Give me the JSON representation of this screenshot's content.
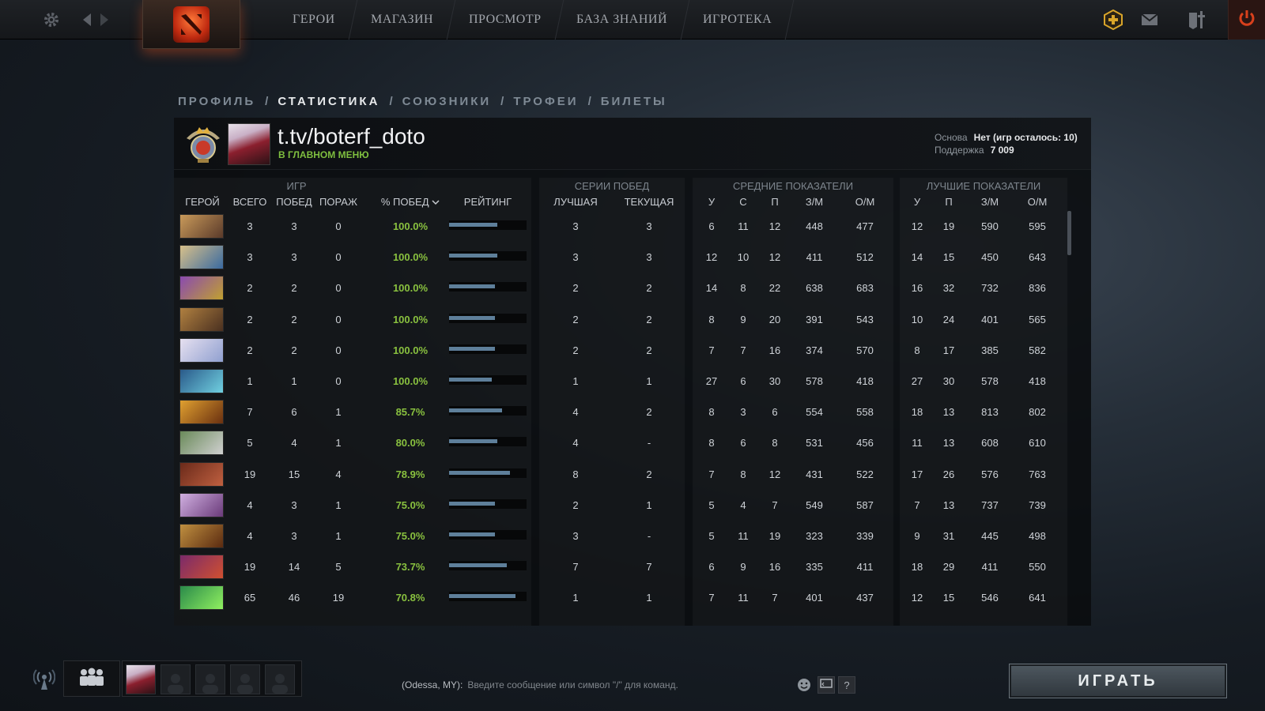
{
  "topbar": {
    "nav": [
      "ГЕРОИ",
      "МАГАЗИН",
      "ПРОСМОТР",
      "БАЗА ЗНАНИЙ",
      "ИГРОТЕКА"
    ]
  },
  "breadcrumbs": [
    "ПРОФИЛЬ",
    "СТАТИСТИКА",
    "СОЮЗНИКИ",
    "ТРОФЕИ",
    "БИЛЕТЫ"
  ],
  "breadcrumb_sep": "/",
  "profile": {
    "name": "t.tv/boterf_doto",
    "status": "В ГЛАВНОМ МЕНЮ",
    "core_label": "Основа",
    "core_value": "Нет (игр осталось: 10)",
    "support_label": "Поддержка",
    "support_value": "7 009"
  },
  "table": {
    "groups": {
      "games": "ИГР",
      "streaks": "СЕРИИ ПОБЕД",
      "avg": "СРЕДНИЕ ПОКАЗАТЕЛИ",
      "best": "ЛУЧШИЕ ПОКАЗАТЕЛИ"
    },
    "columns": {
      "hero": "ГЕРОЙ",
      "total": "ВСЕГО",
      "wins": "ПОБЕД",
      "losses": "ПОРАЖ",
      "winrate": "% ПОБЕД",
      "rating": "РЕЙТИНГ",
      "best_streak": "ЛУЧШАЯ",
      "cur_streak": "ТЕКУЩАЯ",
      "avg_k": "У",
      "avg_d": "С",
      "avg_a": "П",
      "avg_gpm": "З/М",
      "avg_xpm": "О/М",
      "best_k": "У",
      "best_a": "П",
      "best_gpm": "З/М",
      "best_xpm": "О/М"
    },
    "rows": [
      {
        "total": "3",
        "wins": "3",
        "losses": "0",
        "winrate": "100.0%",
        "rating": 0.62,
        "best_streak": "3",
        "cur_streak": "3",
        "avg_k": "6",
        "avg_d": "11",
        "avg_a": "12",
        "avg_gpm": "448",
        "avg_xpm": "477",
        "best_k": "12",
        "best_a": "19",
        "best_gpm": "590",
        "best_xpm": "595"
      },
      {
        "total": "3",
        "wins": "3",
        "losses": "0",
        "winrate": "100.0%",
        "rating": 0.62,
        "best_streak": "3",
        "cur_streak": "3",
        "avg_k": "12",
        "avg_d": "10",
        "avg_a": "12",
        "avg_gpm": "411",
        "avg_xpm": "512",
        "best_k": "14",
        "best_a": "15",
        "best_gpm": "450",
        "best_xpm": "643"
      },
      {
        "total": "2",
        "wins": "2",
        "losses": "0",
        "winrate": "100.0%",
        "rating": 0.59,
        "best_streak": "2",
        "cur_streak": "2",
        "avg_k": "14",
        "avg_d": "8",
        "avg_a": "22",
        "avg_gpm": "638",
        "avg_xpm": "683",
        "best_k": "16",
        "best_a": "32",
        "best_gpm": "732",
        "best_xpm": "836"
      },
      {
        "total": "2",
        "wins": "2",
        "losses": "0",
        "winrate": "100.0%",
        "rating": 0.59,
        "best_streak": "2",
        "cur_streak": "2",
        "avg_k": "8",
        "avg_d": "9",
        "avg_a": "20",
        "avg_gpm": "391",
        "avg_xpm": "543",
        "best_k": "10",
        "best_a": "24",
        "best_gpm": "401",
        "best_xpm": "565"
      },
      {
        "total": "2",
        "wins": "2",
        "losses": "0",
        "winrate": "100.0%",
        "rating": 0.59,
        "best_streak": "2",
        "cur_streak": "2",
        "avg_k": "7",
        "avg_d": "7",
        "avg_a": "16",
        "avg_gpm": "374",
        "avg_xpm": "570",
        "best_k": "8",
        "best_a": "17",
        "best_gpm": "385",
        "best_xpm": "582"
      },
      {
        "total": "1",
        "wins": "1",
        "losses": "0",
        "winrate": "100.0%",
        "rating": 0.55,
        "best_streak": "1",
        "cur_streak": "1",
        "avg_k": "27",
        "avg_d": "6",
        "avg_a": "30",
        "avg_gpm": "578",
        "avg_xpm": "418",
        "best_k": "27",
        "best_a": "30",
        "best_gpm": "578",
        "best_xpm": "418"
      },
      {
        "total": "7",
        "wins": "6",
        "losses": "1",
        "winrate": "85.7%",
        "rating": 0.68,
        "best_streak": "4",
        "cur_streak": "2",
        "avg_k": "8",
        "avg_d": "3",
        "avg_a": "6",
        "avg_gpm": "554",
        "avg_xpm": "558",
        "best_k": "18",
        "best_a": "13",
        "best_gpm": "813",
        "best_xpm": "802"
      },
      {
        "total": "5",
        "wins": "4",
        "losses": "1",
        "winrate": "80.0%",
        "rating": 0.62,
        "best_streak": "4",
        "cur_streak": "-",
        "avg_k": "8",
        "avg_d": "6",
        "avg_a": "8",
        "avg_gpm": "531",
        "avg_xpm": "456",
        "best_k": "11",
        "best_a": "13",
        "best_gpm": "608",
        "best_xpm": "610"
      },
      {
        "total": "19",
        "wins": "15",
        "losses": "4",
        "winrate": "78.9%",
        "rating": 0.79,
        "best_streak": "8",
        "cur_streak": "2",
        "avg_k": "7",
        "avg_d": "8",
        "avg_a": "12",
        "avg_gpm": "431",
        "avg_xpm": "522",
        "best_k": "17",
        "best_a": "26",
        "best_gpm": "576",
        "best_xpm": "763"
      },
      {
        "total": "4",
        "wins": "3",
        "losses": "1",
        "winrate": "75.0%",
        "rating": 0.59,
        "best_streak": "2",
        "cur_streak": "1",
        "avg_k": "5",
        "avg_d": "4",
        "avg_a": "7",
        "avg_gpm": "549",
        "avg_xpm": "587",
        "best_k": "7",
        "best_a": "13",
        "best_gpm": "737",
        "best_xpm": "739"
      },
      {
        "total": "4",
        "wins": "3",
        "losses": "1",
        "winrate": "75.0%",
        "rating": 0.59,
        "best_streak": "3",
        "cur_streak": "-",
        "avg_k": "5",
        "avg_d": "11",
        "avg_a": "19",
        "avg_gpm": "323",
        "avg_xpm": "339",
        "best_k": "9",
        "best_a": "31",
        "best_gpm": "445",
        "best_xpm": "498"
      },
      {
        "total": "19",
        "wins": "14",
        "losses": "5",
        "winrate": "73.7%",
        "rating": 0.74,
        "best_streak": "7",
        "cur_streak": "7",
        "avg_k": "6",
        "avg_d": "9",
        "avg_a": "16",
        "avg_gpm": "335",
        "avg_xpm": "411",
        "best_k": "18",
        "best_a": "29",
        "best_gpm": "411",
        "best_xpm": "550"
      },
      {
        "total": "65",
        "wins": "46",
        "losses": "19",
        "winrate": "70.8%",
        "rating": 0.86,
        "best_streak": "1",
        "cur_streak": "1",
        "avg_k": "7",
        "avg_d": "11",
        "avg_a": "7",
        "avg_gpm": "401",
        "avg_xpm": "437",
        "best_k": "12",
        "best_a": "15",
        "best_gpm": "546",
        "best_xpm": "641"
      }
    ]
  },
  "hero_colors": [
    [
      "#c99a5a",
      "#5a3a2a"
    ],
    [
      "#d8c08a",
      "#3a6aa0"
    ],
    [
      "#8a4ab0",
      "#c0a030"
    ],
    [
      "#b08040",
      "#4a3020"
    ],
    [
      "#e6e0f0",
      "#90a0d0"
    ],
    [
      "#2a5a8a",
      "#70d0e0"
    ],
    [
      "#e0a030",
      "#6a3010"
    ],
    [
      "#6a8a5a",
      "#d0d0d0"
    ],
    [
      "#6a2a1a",
      "#c06040"
    ],
    [
      "#d0b0e0",
      "#6a3a7a"
    ],
    [
      "#c09040",
      "#5a2a10"
    ],
    [
      "#7a2a6a",
      "#d05030"
    ],
    [
      "#2a8a4a",
      "#90f060"
    ]
  ],
  "chat": {
    "channel": "(Odessa, MY):",
    "placeholder": "Введите сообщение или символ \"/\" для команд.",
    "help": "?"
  },
  "play_label": "ИГРАТЬ",
  "colors": {
    "win_green": "#89c13f",
    "status_green": "#7fbf3f",
    "rating_bar": "#5e7f9a"
  },
  "icons": {
    "settings": "gear-icon",
    "back": "arrow-left-icon",
    "forward": "arrow-right-icon",
    "plus": "plus-badge-icon",
    "mail": "mail-icon",
    "armory": "armory-icon",
    "power": "power-icon",
    "broadcast": "antenna-icon",
    "party": "party-icon",
    "emoji": "smiley-icon",
    "chat_expand": "chat-toggle-icon"
  }
}
